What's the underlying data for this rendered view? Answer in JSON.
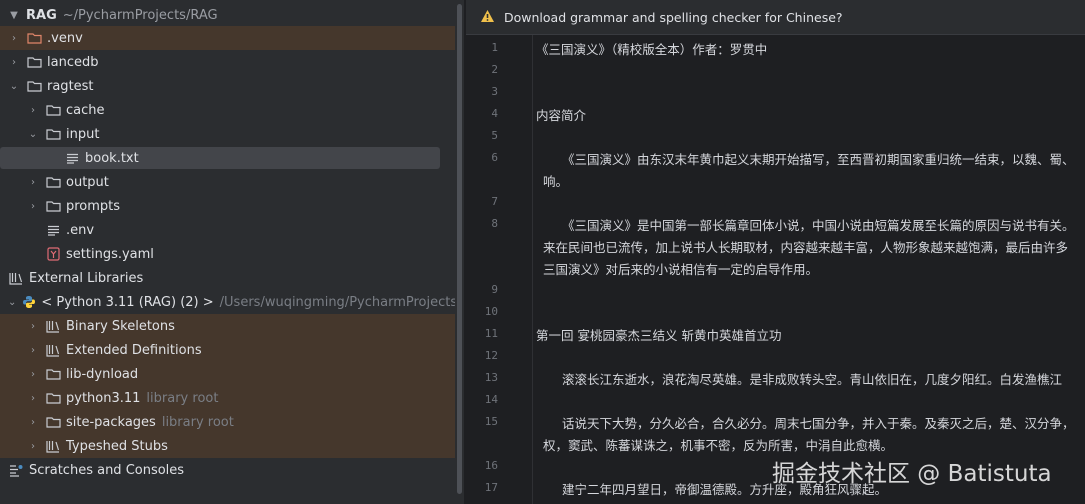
{
  "project": {
    "root_name": "RAG",
    "root_path": "~/PycharmProjects/RAG",
    "items": [
      {
        "label": ".venv",
        "type": "folder",
        "excluded": true
      },
      {
        "label": "lancedb",
        "type": "folder"
      },
      {
        "label": "ragtest",
        "type": "folder"
      },
      {
        "label": "cache",
        "type": "folder"
      },
      {
        "label": "input",
        "type": "folder"
      },
      {
        "label": "book.txt",
        "type": "text-file",
        "selected": true
      },
      {
        "label": "output",
        "type": "folder"
      },
      {
        "label": "prompts",
        "type": "folder"
      },
      {
        "label": ".env",
        "type": "text-file"
      },
      {
        "label": "settings.yaml",
        "type": "yaml-file"
      }
    ],
    "external_libraries": "External Libraries",
    "sdk": {
      "name": "< Python 3.11 (RAG) (2) >",
      "path": "/Users/wuqingming/PycharmProjects/RAG"
    },
    "sdk_items": [
      {
        "label": "Binary Skeletons",
        "type": "library"
      },
      {
        "label": "Extended Definitions",
        "type": "library"
      },
      {
        "label": "lib-dynload",
        "type": "folder"
      },
      {
        "label": "python3.11",
        "type": "folder",
        "hint": "library root"
      },
      {
        "label": "site-packages",
        "type": "folder",
        "hint": "library root"
      },
      {
        "label": "Typeshed Stubs",
        "type": "library"
      }
    ],
    "scratches": "Scratches and Consoles"
  },
  "banner": {
    "text": "Download grammar and spelling checker for Chinese?"
  },
  "editor": {
    "line_numbers": [
      "1",
      "2",
      "3",
      "4",
      "5",
      "6",
      "7",
      "8",
      "9",
      "10",
      "11",
      "12",
      "13",
      "14",
      "15",
      "16",
      "17"
    ],
    "lines": [
      "《三国演义》（精校版全本）作者：罗贯中",
      "内容简介",
      "《三国演义》由东汉末年黄巾起义末期开始描写，至西晋初期国家重归统一结束，以魏、蜀、",
      "响。",
      "《三国演义》是中国第一部长篇章回体小说，中国小说由短篇发展至长篇的原因与说书有关。",
      "来在民间也已流传，加上说书人长期取材，内容越来越丰富，人物形象越来越饱满，最后由许多",
      "三国演义》对后来的小说相信有一定的启导作用。",
      "第一回  宴桃园豪杰三结义  斩黄巾英雄首立功",
      "滚滚长江东逝水，浪花淘尽英雄。是非成败转头空。青山依旧在，几度夕阳红。白发渔樵江",
      "话说天下大势，分久必合，合久必分。周末七国分争，并入于秦。及秦灭之后，楚、汉分争，",
      "权，窦武、陈蕃谋诛之，机事不密，反为所害，中涓自此愈横。",
      "建宁二年四月望日，帝御温德殿。方升座，殿角狂风骤起。"
    ]
  },
  "watermark": "掘金技术社区 @ Batistuta"
}
